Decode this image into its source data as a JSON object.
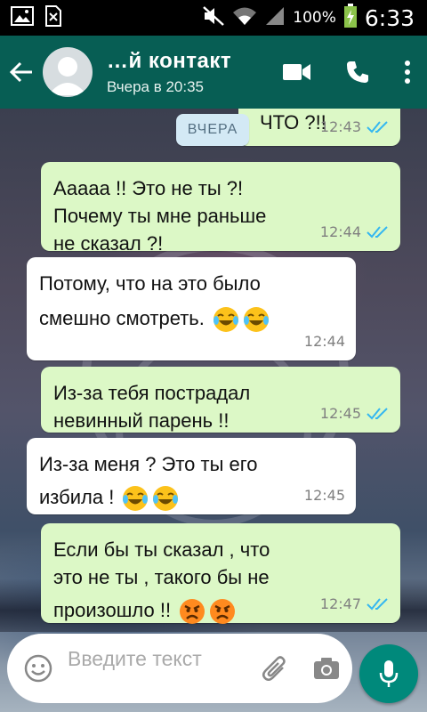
{
  "status_bar": {
    "battery": "100%",
    "time": "6:33"
  },
  "header": {
    "contact_name": "…й контакт",
    "last_seen": "Вчера в 20:35"
  },
  "date_chip": "ВЧЕРА",
  "messages": [
    {
      "direction": "out",
      "lines": [
        "ЧТО ?!!"
      ],
      "time": "12:43",
      "status": "read"
    },
    {
      "direction": "out",
      "lines": [
        "Ааааа !! Это не ты ?!",
        "Почему ты мне раньше",
        "не сказал ?!"
      ],
      "time": "12:44",
      "status": "read"
    },
    {
      "direction": "in",
      "lines": [
        "Потому, что на это было",
        "смешно смотреть."
      ],
      "emoji": [
        "face-with-tears-of-joy",
        "face-with-tears-of-joy"
      ],
      "time": "12:44"
    },
    {
      "direction": "out",
      "lines": [
        "Из-за тебя пострадал",
        "невинный парень !!"
      ],
      "time": "12:45",
      "status": "read"
    },
    {
      "direction": "in",
      "lines": [
        "Из-за меня ? Это ты его",
        "избила !"
      ],
      "emoji": [
        "face-with-tears-of-joy",
        "face-with-tears-of-joy"
      ],
      "time": "12:45"
    },
    {
      "direction": "out",
      "lines": [
        "Если бы ты сказал , что",
        "это не ты , такого бы не",
        "произошло !!"
      ],
      "emoji": [
        "angry-face",
        "angry-face"
      ],
      "time": "12:47",
      "status": "read"
    }
  ],
  "composer": {
    "placeholder": "Введите текст"
  },
  "colors": {
    "header": "#075e54",
    "outgoing": "#dcf8c6",
    "incoming": "#ffffff",
    "read_ticks": "#34b7f1",
    "mic": "#00897b"
  }
}
